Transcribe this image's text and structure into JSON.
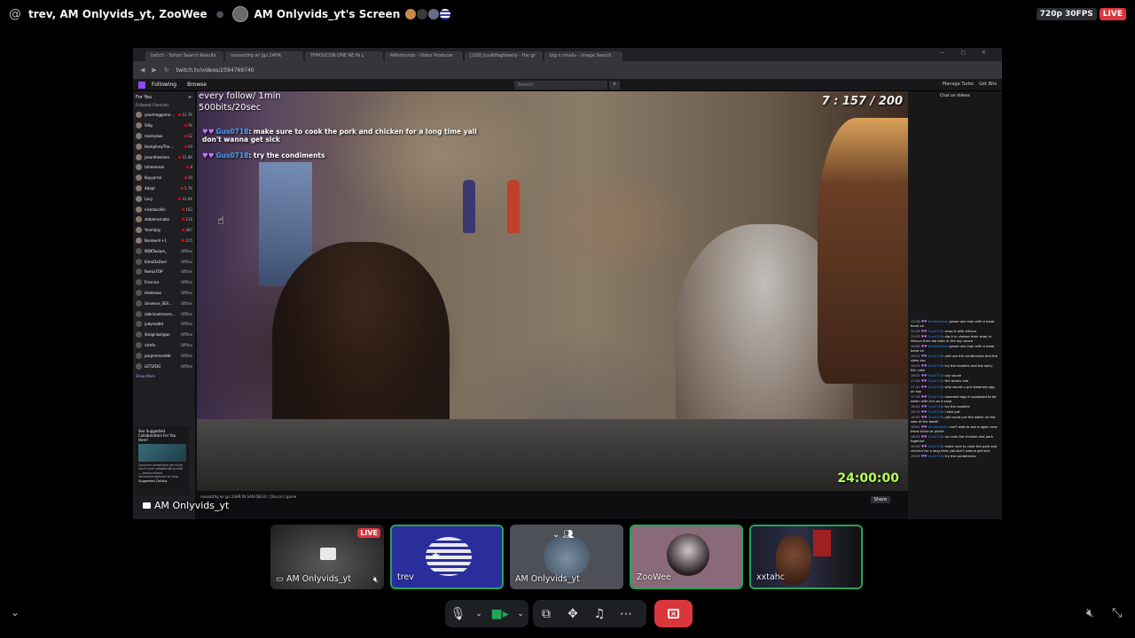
{
  "call": {
    "title": "trev, AM Onlyvids_yt, ZooWee",
    "screen_title": "AM Onlyvids_yt's Screen",
    "quality": "720p 30FPS",
    "live": "LIVE"
  },
  "stream": {
    "browser_tabs": [
      "twitch - Yahoo Search Results",
      "noneatthg w/ jgs 24HR",
      "THPOUCON ONE RE IN L",
      "AMonlyvids - Video Producer",
      "[100] jcsdkflagtkeelly - the gr",
      "big n smalls - Image Search"
    ],
    "url": "twitch.tv/videos/2594769740",
    "twitch_nav": [
      "Following",
      "Browse"
    ],
    "search_placeholder": "Search",
    "twitch_right": [
      "Manage Turbo",
      "Get Bits"
    ],
    "sidebar_title": "For You",
    "sidebar_section": "Followed Channels",
    "channels": [
      {
        "name": "yourmoggame...",
        "count": "12.7K",
        "live": true
      },
      {
        "name": "Silky",
        "count": "7K",
        "live": true
      },
      {
        "name": "rosenylow",
        "count": "12",
        "live": true
      },
      {
        "name": "HumphreyThe...",
        "count": "39",
        "live": true
      },
      {
        "name": "jasonthesmen",
        "count": "15.8K",
        "live": true
      },
      {
        "name": "tuhmenesk",
        "count": "8",
        "live": true
      },
      {
        "name": "Kayyarral",
        "count": "10",
        "live": true
      },
      {
        "name": "Adapt",
        "count": "5.7K",
        "live": true
      },
      {
        "name": "Lacy",
        "count": "41.6K",
        "live": true
      },
      {
        "name": "nickdacollin",
        "count": "162",
        "live": true
      },
      {
        "name": "stablerosnabs",
        "count": "116",
        "live": true
      },
      {
        "name": "YommJay",
        "count": "487",
        "live": true
      },
      {
        "name": "Bookwell +1",
        "count": "415",
        "live": true
      },
      {
        "name": "MDKTaolam_",
        "count": "Offline",
        "live": false
      },
      {
        "name": "KimoDaDoel",
        "count": "Offline",
        "live": false
      },
      {
        "name": "RemixTOP",
        "count": "Offline",
        "live": false
      },
      {
        "name": "Fresnice",
        "count": "Offline",
        "live": false
      },
      {
        "name": "ldvdreoss",
        "count": "Offline",
        "live": false
      },
      {
        "name": "Universe_SES...",
        "count": "Offline",
        "live": false
      },
      {
        "name": "zabrinaelmares...",
        "count": "Offline",
        "live": false
      },
      {
        "name": "judynoidet",
        "count": "Offline",
        "live": false
      },
      {
        "name": "Smiginkolrgan",
        "count": "Offline",
        "live": false
      },
      {
        "name": "cstefo",
        "count": "Offline",
        "live": false
      },
      {
        "name": "purpmenvmbb",
        "count": "Offline",
        "live": false
      },
      {
        "name": "LETSFDO",
        "count": "Offline",
        "live": false
      }
    ],
    "sidebar_show_more": "Show More",
    "suggest_title": "See Suggested Collaborators For You Here!",
    "suggest_text": "Discover streamers we think you'll love collaborating with — personalized recommendations to help",
    "suggest_footer": "Suggested Collabs",
    "overlay_follow": "every follow/ 1min",
    "overlay_bits": "500bits/20sec",
    "overlay_chat": [
      {
        "user": "Gus0718",
        "text": ": make sure to cook the pork and chicken for a long time yall don't wanna get sick"
      },
      {
        "user": "Gus0718",
        "text": ": try the condiments"
      }
    ],
    "goal": "7 : 157 / 200",
    "timer": "24:00:00",
    "below_title": "AM Onlyvids_yt",
    "below_desc": "noneatthg w/ jgs 24HR IN SAN DIEGO | Discord !game",
    "share": "Share",
    "chat_title": "Chat on Videos",
    "chat_messages": [
      {
        "time": "15:28",
        "user": "tuhmenhiet",
        "text": "grown ass man with a head band on"
      },
      {
        "time": "15:29",
        "user": "Gus0718",
        "text": "wrap it with lettuce"
      },
      {
        "time": "15:35",
        "user": "Gus0718",
        "text": "dip it in cheese then wrap in lettuce then dip both in the soy sauce"
      },
      {
        "time": "16:06",
        "user": "tuhmenhiet",
        "text": "grown ass man with a head band on"
      },
      {
        "time": "16:21",
        "user": "Gus0718",
        "text": "yall use the condiments and the sides too"
      },
      {
        "time": "16:25",
        "user": "Gus0718",
        "text": "try the noodles and the spicy fish cake"
      },
      {
        "time": "16:52",
        "user": "Gus0718",
        "text": "soy sauce"
      },
      {
        "time": "17:04",
        "user": "Gus0718",
        "text": "the brown one"
      },
      {
        "time": "17:10",
        "user": "Gus0718",
        "text": "why would u put steamed egg on top"
      },
      {
        "time": "17:16",
        "user": "Gus0718",
        "text": "steamed egg is supposed to be eaten with rice as a soup"
      },
      {
        "time": "18:01",
        "user": "Gus0718",
        "text": "try the noodles"
      },
      {
        "time": "18:15",
        "user": "Gus0718",
        "text": "I told yall"
      },
      {
        "time": "18:42",
        "user": "Gus0718",
        "text": "yall could put the water on the side of the booth"
      },
      {
        "time": "18:51",
        "user": "tuhmenhiet",
        "text": "can't wait to see a again new tmrw tickle or pickle"
      },
      {
        "time": "18:53",
        "user": "Gus0718",
        "text": "no cook the chicken and pork together"
      },
      {
        "time": "18:56",
        "user": "Gus0718",
        "text": "make sure to cook the pork and chicken for a long time yall don't wanna get sick"
      },
      {
        "time": "18:59",
        "user": "Gus0718",
        "text": "try the condiments"
      }
    ]
  },
  "caption": "AM Onlyvids_yt",
  "tiles": [
    {
      "name": "AM Onlyvids_yt",
      "live": "LIVE"
    },
    {
      "name": "trev"
    },
    {
      "name": "AM Onlyvids_yt"
    },
    {
      "name": "ZooWee"
    },
    {
      "name": "xxtahc"
    }
  ],
  "colors": {
    "live_red": "#da373c",
    "speaking_green": "#23a55a",
    "twitch_purple": "#9147ff",
    "timer_green": "#b6ff5a"
  },
  "icons": {
    "mic": "microphone-icon",
    "camera": "camera-icon",
    "share": "screen-share-icon",
    "activity": "activity-icon",
    "soundboard": "soundboard-icon",
    "more": "more-icon",
    "leave": "leave-call-icon",
    "volume": "volume-mute-icon",
    "fullscreen": "exit-fullscreen-icon",
    "collapse": "chevron-down-icon"
  }
}
